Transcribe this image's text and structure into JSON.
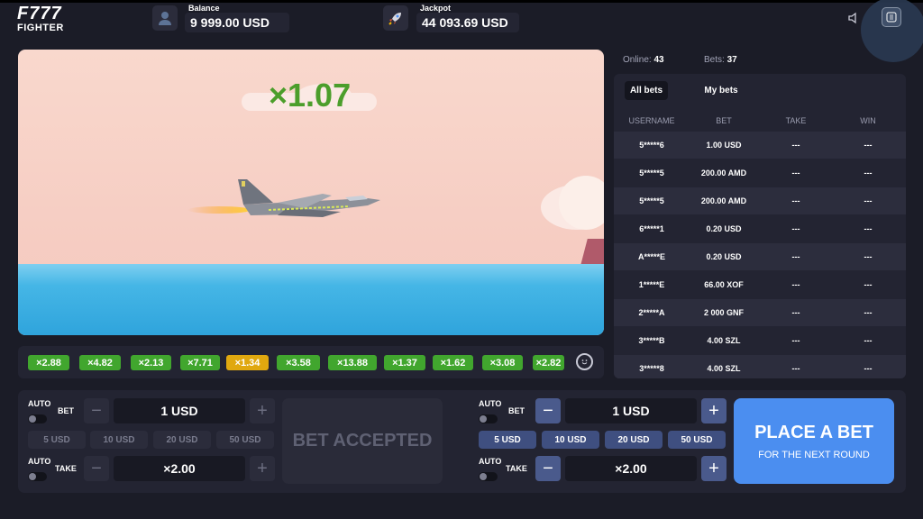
{
  "logo": {
    "line1": "F777",
    "line2": "FIGHTER"
  },
  "header": {
    "balance_label": "Balance",
    "balance_value": "9 999.00 USD",
    "jackpot_label": "Jackpot",
    "jackpot_value": "44 093.69 USD",
    "user_icon": "user-icon",
    "jackpot_icon": "rocket-icon",
    "sound_icon": "speaker-icon"
  },
  "game": {
    "multiplier": "×1.07"
  },
  "history": [
    "×2.88",
    "×4.82",
    "×2.13",
    "×7.71",
    "×1.34",
    "×3.58",
    "×13.88",
    "×1.37",
    "×1.62",
    "×3.08",
    "×2.82"
  ],
  "stats": {
    "online_label": "Online:",
    "online_value": "43",
    "bets_label": "Bets:",
    "bets_value": "37"
  },
  "bets_panel": {
    "tabs": [
      "All bets",
      "My bets"
    ],
    "columns": [
      "USERNAME",
      "BET",
      "TAKE",
      "WIN"
    ],
    "rows": [
      {
        "user": "5*****6",
        "bet": "1.00 USD",
        "take": "---",
        "win": "---"
      },
      {
        "user": "5*****5",
        "bet": "200.00 AMD",
        "take": "---",
        "win": "---"
      },
      {
        "user": "5*****5",
        "bet": "200.00 AMD",
        "take": "---",
        "win": "---"
      },
      {
        "user": "6*****1",
        "bet": "0.20 USD",
        "take": "---",
        "win": "---"
      },
      {
        "user": "A*****E",
        "bet": "0.20 USD",
        "take": "---",
        "win": "---"
      },
      {
        "user": "1*****E",
        "bet": "66.00 XOF",
        "take": "---",
        "win": "---"
      },
      {
        "user": "2*****A",
        "bet": "2 000 GNF",
        "take": "---",
        "win": "---"
      },
      {
        "user": "3*****B",
        "bet": "4.00 SZL",
        "take": "---",
        "win": "---"
      },
      {
        "user": "3*****8",
        "bet": "4.00 SZL",
        "take": "---",
        "win": "---"
      }
    ]
  },
  "left_bet": {
    "auto_label": "AUTO",
    "bet_label": "BET",
    "take_label": "TAKE",
    "bet_value": "1 USD",
    "take_value": "×2.00",
    "presets": [
      "5 USD",
      "10 USD",
      "20 USD",
      "50 USD"
    ],
    "minus": "−",
    "plus": "+",
    "accepted_label": "BET ACCEPTED"
  },
  "right_bet": {
    "auto_label": "AUTO",
    "bet_label": "BET",
    "take_label": "TAKE",
    "bet_value": "1 USD",
    "take_value": "×2.00",
    "presets": [
      "5 USD",
      "10 USD",
      "20 USD",
      "50 USD"
    ],
    "minus": "−",
    "plus": "+",
    "place_label": "PLACE A BET",
    "place_sub": "FOR THE NEXT ROUND"
  },
  "colors": {
    "background": "#1b1c27",
    "panel": "#232432",
    "multiplier_green": "#4b9e2b",
    "chip_green": "#41a62e",
    "chip_yellow": "#e0a80f",
    "place_button": "#4b8ef0"
  }
}
